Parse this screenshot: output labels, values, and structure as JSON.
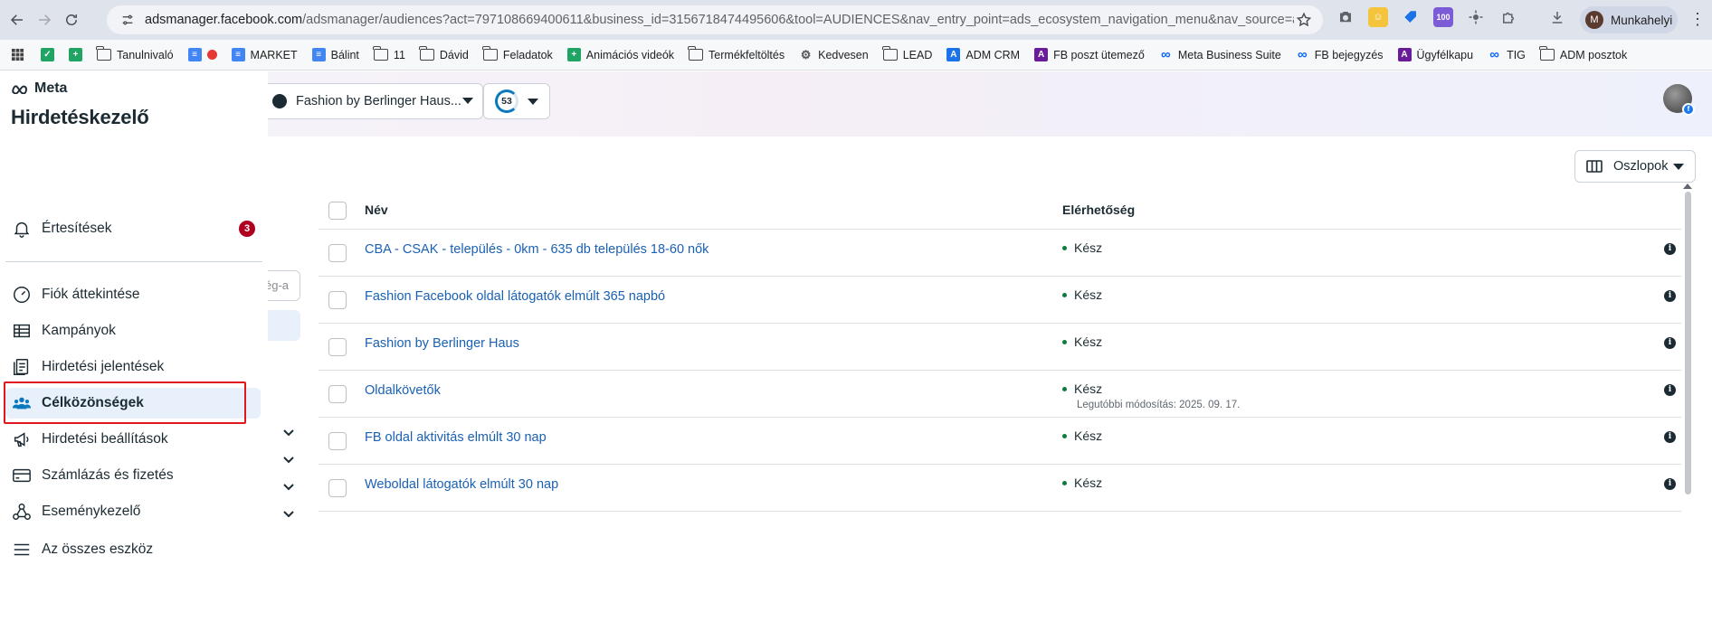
{
  "browser": {
    "url_host": "adsmanager.facebook.com",
    "url_path": "/adsmanager/audiences?act=797108669400611&business_id=3156718474495606&tool=AUDIENCES&nav_entry_point=ads_ecosystem_navigation_menu&nav_source=ads_ma...",
    "profile_initial": "M",
    "profile_label": "Munkahelyi",
    "extension_badge": "100"
  },
  "bookmarks": [
    {
      "label": "",
      "icon": "green-check-icon"
    },
    {
      "label": "",
      "icon": "sheets-icon"
    },
    {
      "label": "Tanulnivaló",
      "icon": "folder-icon"
    },
    {
      "label": "",
      "icon": "docs-icon"
    },
    {
      "label": "MARKET",
      "icon": "docs-icon"
    },
    {
      "label": "Bálint",
      "icon": "docs-icon"
    },
    {
      "label": "11",
      "icon": "folder-icon"
    },
    {
      "label": "Dávid",
      "icon": "folder-icon"
    },
    {
      "label": "Feladatok",
      "icon": "folder-icon"
    },
    {
      "label": "Animációs videók",
      "icon": "sheets-icon"
    },
    {
      "label": "Termékfeltöltés",
      "icon": "folder-icon"
    },
    {
      "label": "Kedvesen",
      "icon": "gear-icon"
    },
    {
      "label": "LEAD",
      "icon": "folder-icon"
    },
    {
      "label": "ADM CRM",
      "icon": "a-app-icon"
    },
    {
      "label": "FB poszt ütemező",
      "icon": "a-purple-icon"
    },
    {
      "label": "Meta Business Suite",
      "icon": "meta-icon"
    },
    {
      "label": "FB bejegyzés",
      "icon": "meta-icon"
    },
    {
      "label": "Ügyfélkapu",
      "icon": "a-purple-icon"
    },
    {
      "label": "TIG",
      "icon": "meta-icon"
    },
    {
      "label": "ADM posztok",
      "icon": "folder-icon"
    }
  ],
  "header": {
    "account_name": "Fashion by Berlinger Haus...",
    "count": "53"
  },
  "sidebar": {
    "brand": "Meta",
    "title": "Hirdetéskezelő",
    "notifications": {
      "label": "Értesítések",
      "badge": "3"
    },
    "items": [
      {
        "label": "Fiók áttekintése",
        "icon": "gauge-icon"
      },
      {
        "label": "Kampányok",
        "icon": "table-icon"
      },
      {
        "label": "Hirdetési jelentések",
        "icon": "report-icon"
      },
      {
        "label": "Célközönségek",
        "icon": "people-icon",
        "active": true
      },
      {
        "label": "Hirdetési beállítások",
        "icon": "megaphone-icon"
      },
      {
        "label": "Számlázás és fizetés",
        "icon": "credit-card-icon"
      },
      {
        "label": "Eseménykezelő",
        "icon": "nodes-icon"
      },
      {
        "label": "Az összes eszköz",
        "icon": "menu-icon"
      }
    ]
  },
  "remnants": {
    "search_text": "ég-a"
  },
  "table": {
    "columns_button": "Oszlopok",
    "headers": {
      "name": "Név",
      "availability": "Elérhetőség"
    },
    "rows": [
      {
        "name": "CBA - CSAK - település - 0km - 635 db település 18-60 nők",
        "status": "Kész",
        "sub": ""
      },
      {
        "name": "Fashion Facebook oldal látogatók elmúlt 365 napbó",
        "status": "Kész",
        "sub": ""
      },
      {
        "name": "Fashion by Berlinger Haus",
        "status": "Kész",
        "sub": ""
      },
      {
        "name": "Oldalkövetők",
        "status": "Kész",
        "sub": "Legutóbbi módosítás: 2025. 09. 17."
      },
      {
        "name": "FB oldal aktivitás elmúlt 30 nap",
        "status": "Kész",
        "sub": ""
      },
      {
        "name": "Weboldal látogatók elmúlt 30 nap",
        "status": "Kész",
        "sub": ""
      }
    ]
  }
}
